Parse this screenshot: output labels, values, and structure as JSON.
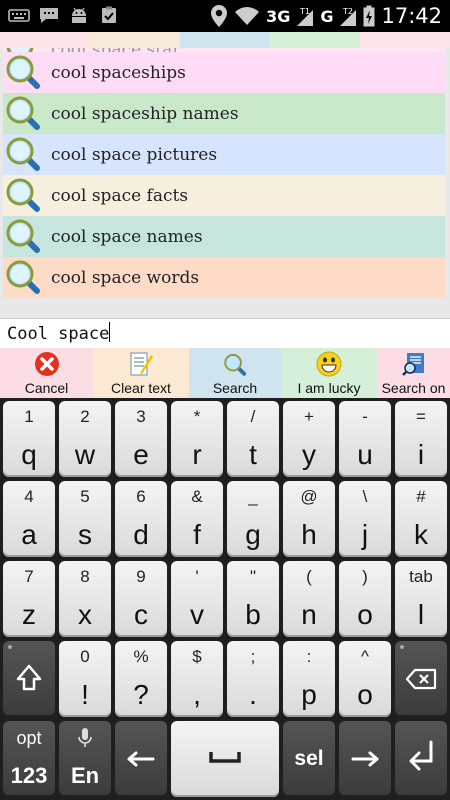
{
  "status_bar": {
    "net_3g": "3G",
    "sim1_badge": "T1",
    "net_g": "G",
    "sim2_badge": "T2",
    "time": "17:42"
  },
  "suggestions": {
    "partial_top": "cool space star",
    "items": [
      {
        "text": "cool spaceships",
        "color": "#fedcf6"
      },
      {
        "text": "cool spaceship names",
        "color": "#c9e8c9"
      },
      {
        "text": "cool space pictures",
        "color": "#d6e5fd"
      },
      {
        "text": "cool space facts",
        "color": "#f6efdd"
      },
      {
        "text": "cool space names",
        "color": "#c6e5de"
      },
      {
        "text": "cool space words",
        "color": "#fddbc7"
      }
    ]
  },
  "search_input": {
    "value": "Cool space"
  },
  "actions": [
    {
      "label": "Cancel",
      "color": "#fddde4",
      "icon": "cancel-icon"
    },
    {
      "label": "Clear text",
      "color": "#fbe9d3",
      "icon": "clear-text-icon"
    },
    {
      "label": "Search",
      "color": "#cfe4ee",
      "icon": "search-icon"
    },
    {
      "label": "I am lucky",
      "color": "#d5f0d8",
      "icon": "smiley-icon"
    },
    {
      "label": "Search on",
      "color": "#fddde4",
      "icon": "search-on-icon"
    }
  ],
  "keyboard": {
    "row1": [
      {
        "alt": "1",
        "main": "q"
      },
      {
        "alt": "2",
        "main": "w"
      },
      {
        "alt": "3",
        "main": "e"
      },
      {
        "alt": "*",
        "main": "r"
      },
      {
        "alt": "/",
        "main": "t"
      },
      {
        "alt": "+",
        "main": "y"
      },
      {
        "alt": "-",
        "main": "u"
      },
      {
        "alt": "=",
        "main": "i"
      }
    ],
    "row2": [
      {
        "alt": "4",
        "main": "a"
      },
      {
        "alt": "5",
        "main": "s"
      },
      {
        "alt": "6",
        "main": "d"
      },
      {
        "alt": "&",
        "main": "f"
      },
      {
        "alt": "_",
        "main": "g"
      },
      {
        "alt": "@",
        "main": "h"
      },
      {
        "alt": "\\",
        "main": "j"
      },
      {
        "alt": "#",
        "main": "k"
      }
    ],
    "row3": [
      {
        "alt": "7",
        "main": "z"
      },
      {
        "alt": "8",
        "main": "x"
      },
      {
        "alt": "9",
        "main": "c"
      },
      {
        "alt": "'",
        "main": "v"
      },
      {
        "alt": "\"",
        "main": "b"
      },
      {
        "alt": "(",
        "main": "n"
      },
      {
        "alt": ")",
        "main": "o"
      },
      {
        "alt": "tab",
        "main": "l"
      }
    ],
    "row4": [
      {
        "alt": "0",
        "main": "!"
      },
      {
        "alt": "%",
        "main": "?"
      },
      {
        "alt": "$",
        "main": ","
      },
      {
        "alt": ";",
        "main": "."
      },
      {
        "alt": ":",
        "main": "p"
      },
      {
        "alt": "^",
        "main": "o"
      }
    ],
    "opt_label": "opt",
    "num_label": "123",
    "lang_label": "En",
    "sel_label": "sel"
  }
}
